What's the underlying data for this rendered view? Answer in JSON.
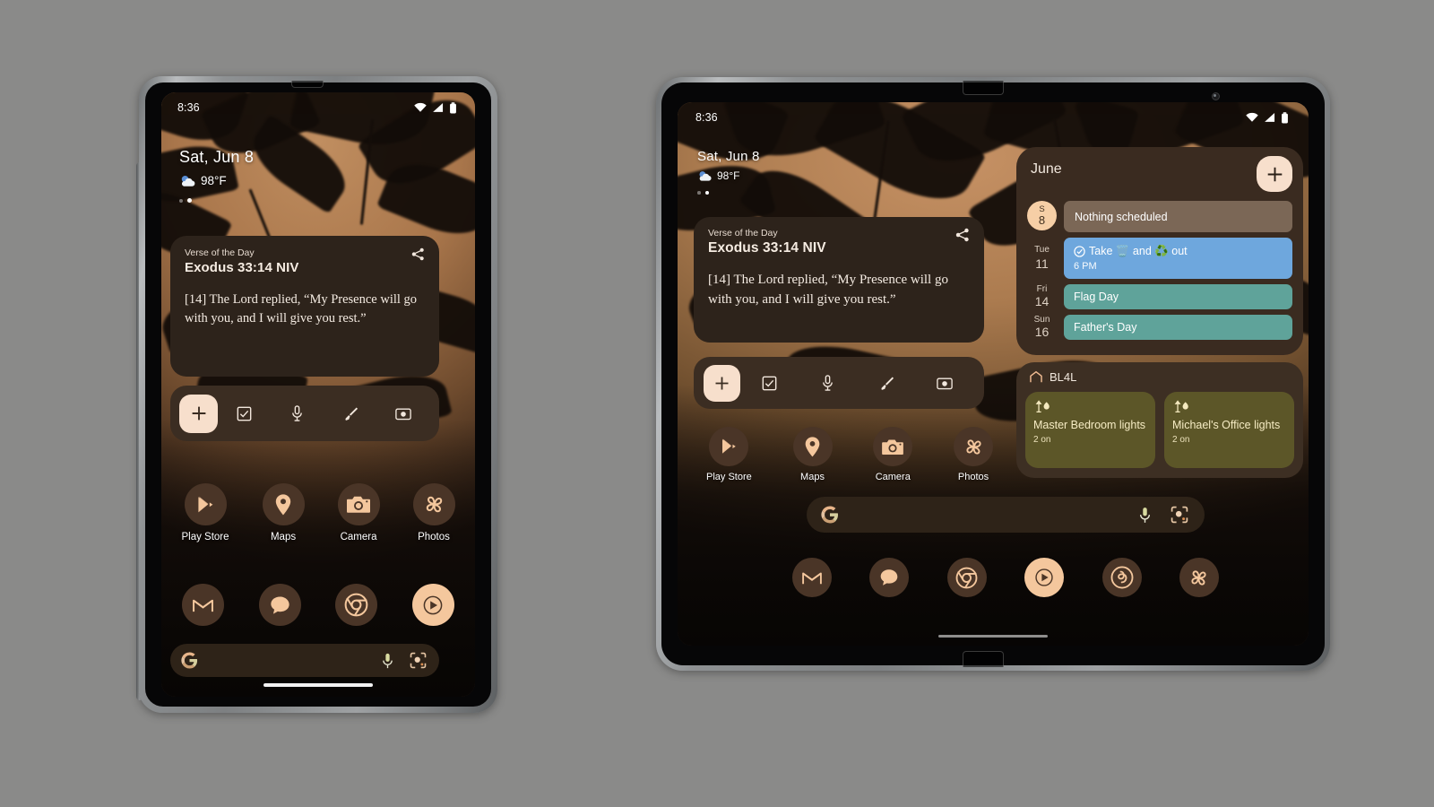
{
  "theme": {
    "page_bg": "#8a8a89",
    "accent_peach": "#f7dfcc",
    "widget_brown": "#2d231b",
    "calendar_brown": "#3a2b20",
    "chip_blue": "#6ea7dd",
    "chip_teal": "#5fa39a",
    "chip_gray": "#7b6756",
    "tile_olive": "#5c5628",
    "today_circle": "#f6cfa6"
  },
  "status_bar": {
    "time": "8:36",
    "icons": [
      "wifi-icon",
      "signal-icon",
      "battery-icon"
    ]
  },
  "at_a_glance": {
    "date": "Sat, Jun 8",
    "temperature": "98°F",
    "weather_icon": "partly-cloudy-icon",
    "page_dots": 2,
    "active_dot": 2
  },
  "verse_widget": {
    "label": "Verse of the Day",
    "reference": "Exodus 33:14 NIV",
    "body": "[14] The Lord replied, “My Presence will go with you, and I will give you rest.”",
    "share_icon": "share-icon"
  },
  "keep_toolbar": {
    "items": [
      {
        "icon": "plus-icon",
        "name": "new-note-button"
      },
      {
        "icon": "checkbox-icon",
        "name": "new-list-button"
      },
      {
        "icon": "microphone-icon",
        "name": "voice-note-button"
      },
      {
        "icon": "brush-icon",
        "name": "drawing-note-button"
      },
      {
        "icon": "camera-icon",
        "name": "photo-note-button"
      }
    ]
  },
  "app_row_labeled": [
    {
      "label": "Play Store",
      "icon": "play-store-icon"
    },
    {
      "label": "Maps",
      "icon": "maps-pin-icon"
    },
    {
      "label": "Camera",
      "icon": "camera-icon"
    },
    {
      "label": "Photos",
      "icon": "photos-pinwheel-icon"
    }
  ],
  "dock_phone": [
    {
      "label": "Gmail",
      "icon": "gmail-icon"
    },
    {
      "label": "Messages",
      "icon": "messages-icon"
    },
    {
      "label": "Chrome",
      "icon": "chrome-icon"
    },
    {
      "label": "YouTube Music",
      "icon": "youtube-music-icon"
    }
  ],
  "dock_tablet": [
    {
      "label": "Gmail",
      "icon": "gmail-icon"
    },
    {
      "label": "Messages",
      "icon": "messages-icon"
    },
    {
      "label": "Chrome",
      "icon": "chrome-icon"
    },
    {
      "label": "YouTube Music",
      "icon": "youtube-music-icon"
    },
    {
      "label": "Threads",
      "icon": "threads-icon"
    },
    {
      "label": "Photos",
      "icon": "photos-pinwheel-icon"
    }
  ],
  "search_bar": {
    "placeholder": "",
    "value": "",
    "logo_icon": "google-g-icon",
    "mic_icon": "microphone-icon",
    "lens_icon": "google-lens-icon"
  },
  "calendar_widget": {
    "month": "June",
    "add_label": "+",
    "rows": [
      {
        "dow": "S",
        "day": "8",
        "today": true,
        "title": "Nothing scheduled",
        "time": "",
        "color": "#7b6756",
        "has_check": false,
        "emoji_a": "",
        "emoji_b": ""
      },
      {
        "dow": "Tue",
        "day": "11",
        "today": false,
        "title": "Take 🗑️ and ♻️ out",
        "time": "6 PM",
        "color": "#6ea7dd",
        "has_check": true,
        "emoji_a": "🗑️",
        "emoji_b": "♻️"
      },
      {
        "dow": "Fri",
        "day": "14",
        "today": false,
        "title": "Flag Day",
        "time": "",
        "color": "#5fa39a",
        "has_check": false,
        "emoji_a": "",
        "emoji_b": ""
      },
      {
        "dow": "Sun",
        "day": "16",
        "today": false,
        "title": "Father's Day",
        "time": "",
        "color": "#5fa39a",
        "has_check": false,
        "emoji_a": "",
        "emoji_b": ""
      }
    ]
  },
  "home_widget": {
    "home_icon": "home-icon",
    "title": "BL4L",
    "tiles": [
      {
        "icon": "lamp-icon",
        "name": "Master Bedroom lights",
        "status": "2 on"
      },
      {
        "icon": "lamp-icon",
        "name": "Michael's Office lights",
        "status": "2 on"
      }
    ]
  }
}
